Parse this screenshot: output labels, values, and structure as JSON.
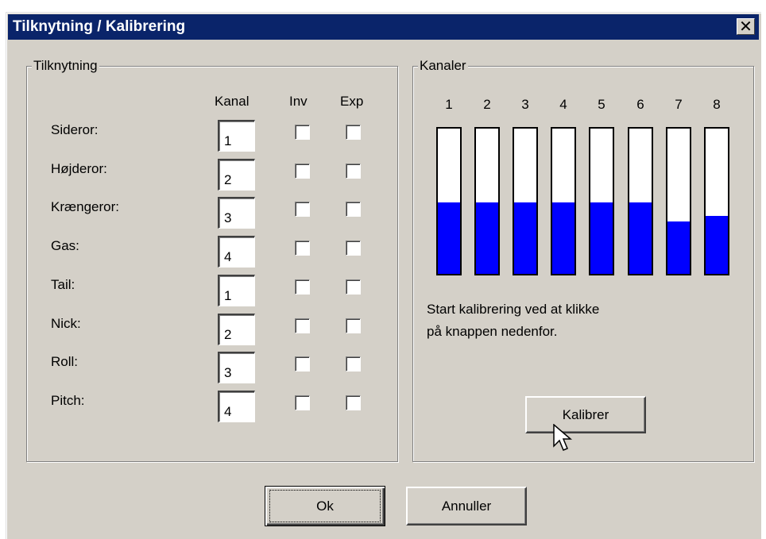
{
  "window": {
    "title": "Tilknytning / Kalibrering",
    "close_glyph": "✕"
  },
  "tilknytning": {
    "legend": "Tilknytning",
    "headers": {
      "kanal": "Kanal",
      "inv": "Inv",
      "exp": "Exp"
    },
    "rows": [
      {
        "label": "Sideror:",
        "kanal": "1",
        "inv": false,
        "exp": false
      },
      {
        "label": "Højderor:",
        "kanal": "2",
        "inv": false,
        "exp": false
      },
      {
        "label": "Krængeror:",
        "kanal": "3",
        "inv": false,
        "exp": false
      },
      {
        "label": "Gas:",
        "kanal": "4",
        "inv": false,
        "exp": false
      },
      {
        "label": "Tail:",
        "kanal": "1",
        "inv": false,
        "exp": false
      },
      {
        "label": "Nick:",
        "kanal": "2",
        "inv": false,
        "exp": false
      },
      {
        "label": "Roll:",
        "kanal": "3",
        "inv": false,
        "exp": false
      },
      {
        "label": "Pitch:",
        "kanal": "4",
        "inv": false,
        "exp": false
      }
    ]
  },
  "kanaler": {
    "legend": "Kanaler",
    "channels": [
      {
        "number": "1",
        "level": 0.49
      },
      {
        "number": "2",
        "level": 0.49
      },
      {
        "number": "3",
        "level": 0.49
      },
      {
        "number": "4",
        "level": 0.49
      },
      {
        "number": "5",
        "level": 0.49
      },
      {
        "number": "6",
        "level": 0.49
      },
      {
        "number": "7",
        "level": 0.36
      },
      {
        "number": "8",
        "level": 0.4
      }
    ],
    "instruction_line1": "Start kalibrering ved at klikke",
    "instruction_line2": "på knappen nedenfor.",
    "calibrate_label": "Kalibrer"
  },
  "buttons": {
    "ok": "Ok",
    "cancel": "Annuller"
  },
  "colors": {
    "titlebar": "#0a246a",
    "bar_fill": "#0000ff",
    "face": "#d4d0c8"
  }
}
